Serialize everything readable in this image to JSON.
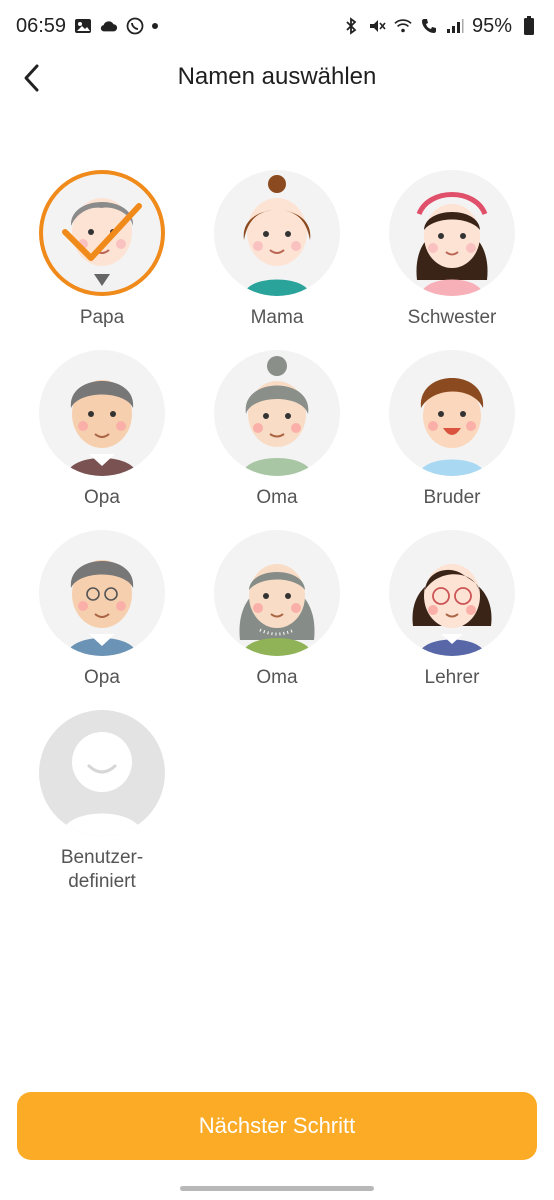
{
  "status": {
    "time": "06:59",
    "battery": "95%",
    "icons_left": [
      "gallery-icon",
      "cloud-icon",
      "whatsapp-icon",
      "dot-icon"
    ],
    "icons_right": [
      "bluetooth-icon",
      "mute-icon",
      "wifi-icon",
      "call-icon",
      "signal-icon",
      "battery-icon"
    ]
  },
  "header": {
    "title": "Namen auswählen",
    "back_icon": "chevron-left-icon"
  },
  "accent": "#f08a1a",
  "button_color": "#fbab26",
  "names": {
    "papa": "Papa",
    "mama": "Mama",
    "schwester": "Schwester",
    "opa1": "Opa",
    "oma1": "Oma",
    "bruder": "Bruder",
    "opa2": "Opa",
    "oma2": "Oma",
    "lehrer": "Lehrer",
    "custom_line1": "Benutzer-",
    "custom_line2": "definiert"
  },
  "selected": "Papa",
  "footer": {
    "next_label": "Nächster Schritt"
  }
}
